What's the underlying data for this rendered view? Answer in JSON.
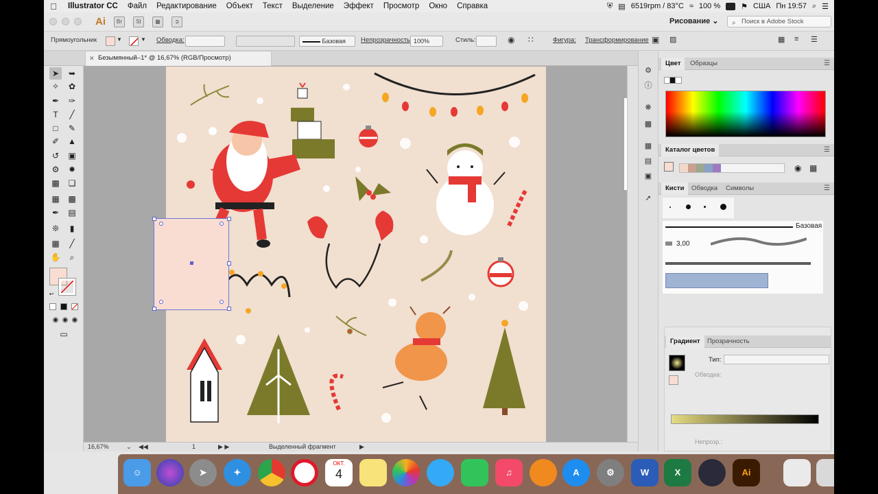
{
  "menubar": {
    "app_name": "Illustrator CC",
    "menus": [
      "Файл",
      "Редактирование",
      "Объект",
      "Текст",
      "Выделение",
      "Эффект",
      "Просмотр",
      "Окно",
      "Справка"
    ],
    "status": "6519rpm / 83°C",
    "battery": "100 %",
    "locale": "США",
    "clock": "Пн 19:57"
  },
  "titlebar": {
    "app_badge": "Ai",
    "badge_br": "Br",
    "badge_st": "St",
    "workspace": "Рисование",
    "search_placeholder": "Поиск в Adobe Stock"
  },
  "controlbar": {
    "object_type": "Прямоугольник",
    "stroke_label": "Обводка:",
    "stroke_style": "Базовая",
    "opacity_label": "Непрозрачность:",
    "opacity_value": "100%",
    "style_label": "Стиль:",
    "shape_label": "Фигура:",
    "transform_label": "Трансформирование"
  },
  "document": {
    "tab_title": "Безымянный–1* @ 16,67% (RGB/Просмотр)",
    "zoom": "16,67%",
    "artboard_num": "1",
    "status_text": "Выделенный фрагмент"
  },
  "panels": {
    "color_tabs": [
      "Цвет",
      "Образцы"
    ],
    "catalog_title": "Каталог цветов",
    "brush_tabs": [
      "Кисти",
      "Обводка",
      "Символы"
    ],
    "brush_basic": "Базовая",
    "brush_size": "3,00",
    "gradient_tabs": [
      "Градиент",
      "Прозрачность"
    ],
    "gradient_type_label": "Тип:",
    "gradient_stroke_label": "Обводка:",
    "gradient_opacity_label": "Непрозр.:"
  },
  "colors": {
    "artboard": "#f1dfd0",
    "selection": "#6f74d6",
    "fill_swatch": "#f9ddd2",
    "santa_red": "#e53935",
    "tree_green": "#7b7a2a"
  },
  "dock": {
    "calendar_month": "ОКТ.",
    "calendar_day": "4",
    "apps": [
      "finder-icon",
      "siri-icon",
      "launchpad-icon",
      "safari-icon",
      "chrome-icon",
      "opera-icon",
      "calendar-icon",
      "notes-icon",
      "photos-icon",
      "messages-icon",
      "facetime-icon",
      "music-icon",
      "books-icon",
      "appstore-icon",
      "settings-icon",
      "word-icon",
      "excel-icon",
      "obs-icon",
      "illustrator-icon",
      "preview-icon",
      "trash-icon"
    ]
  }
}
